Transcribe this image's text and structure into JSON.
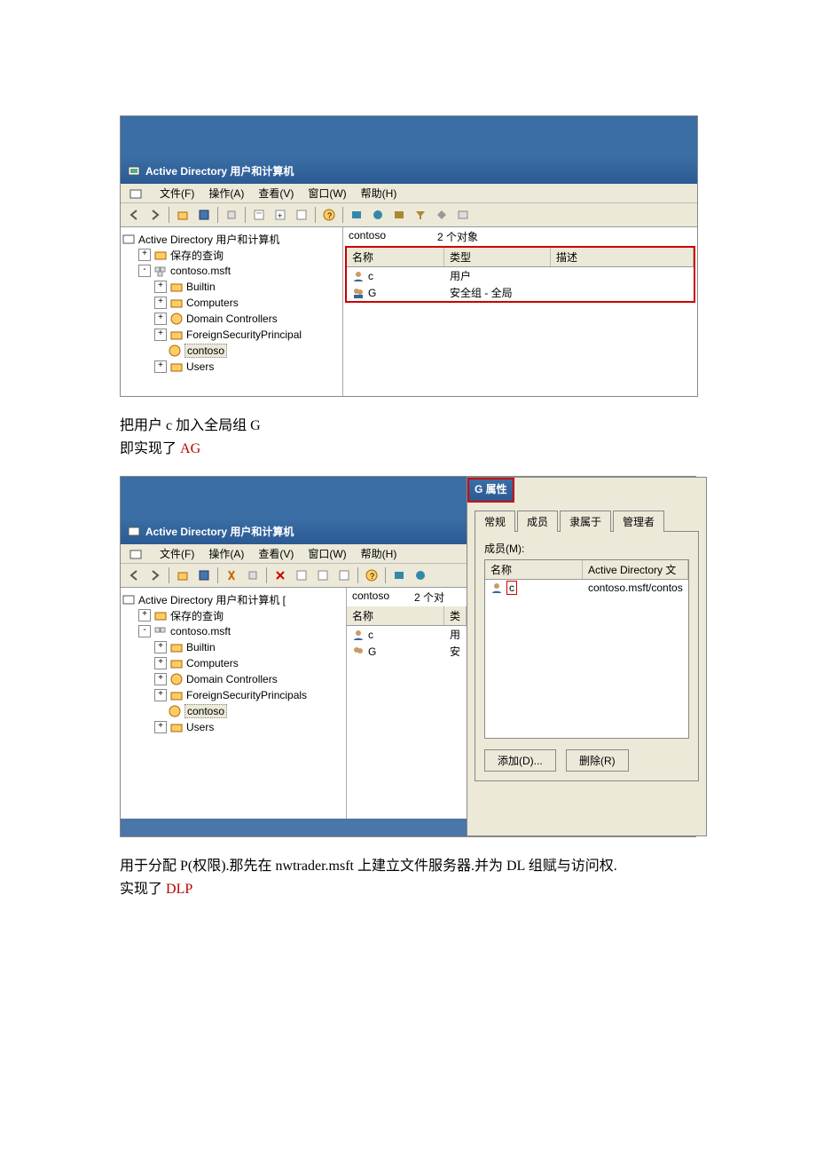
{
  "win1": {
    "title": "Active Directory 用户和计算机",
    "menu": {
      "file": "文件(F)",
      "action": "操作(A)",
      "view": "查看(V)",
      "window": "窗口(W)",
      "help": "帮助(H)"
    },
    "tree": {
      "root": "Active Directory 用户和计算机",
      "saved": "保存的查询",
      "domain": "contoso.msft",
      "builtin": "Builtin",
      "computers": "Computers",
      "dc": "Domain Controllers",
      "fsp": "ForeignSecurityPrincipal",
      "contoso": "contoso",
      "users": "Users"
    },
    "list": {
      "path": "contoso",
      "count": "2 个对象",
      "col_name": "名称",
      "col_type": "类型",
      "col_desc": "描述",
      "rows": [
        {
          "name": "c",
          "type": "用户"
        },
        {
          "name": "G",
          "type": "安全组 - 全局"
        }
      ]
    }
  },
  "text1a": "把用户 c 加入全局组 G",
  "text1b_prefix": "即实现了 ",
  "text1b_red": "AG",
  "win2": {
    "title": "Active Directory 用户和计算机",
    "tree": {
      "root": "Active Directory 用户和计算机 [",
      "saved": "保存的查询",
      "domain": "contoso.msft",
      "builtin": "Builtin",
      "computers": "Computers",
      "dc": "Domain Controllers",
      "fsp": "ForeignSecurityPrincipals",
      "contoso": "contoso",
      "users": "Users"
    },
    "list": {
      "path": "contoso",
      "count": "2 个对",
      "col_name": "名称",
      "col_t": "类",
      "rows": [
        {
          "name": "c",
          "t": "用"
        },
        {
          "name": "G",
          "t": "安"
        }
      ]
    }
  },
  "dlg": {
    "title": "G 属性",
    "tabs": {
      "general": "常规",
      "members": "成员",
      "memberof": "隶属于",
      "managed": "管理者"
    },
    "members_label": "成员(M):",
    "col_name": "名称",
    "col_folder": "Active Directory 文",
    "member": {
      "name": "c",
      "folder": "contoso.msft/contos"
    },
    "add": "添加(D)...",
    "remove": "删除(R)"
  },
  "text2a": "用于分配 P(权限).那先在 nwtrader.msft 上建立文件服务器.并为 DL 组赋与访问权.",
  "text2b_prefix": "实现了 ",
  "text2b_red": "DLP"
}
